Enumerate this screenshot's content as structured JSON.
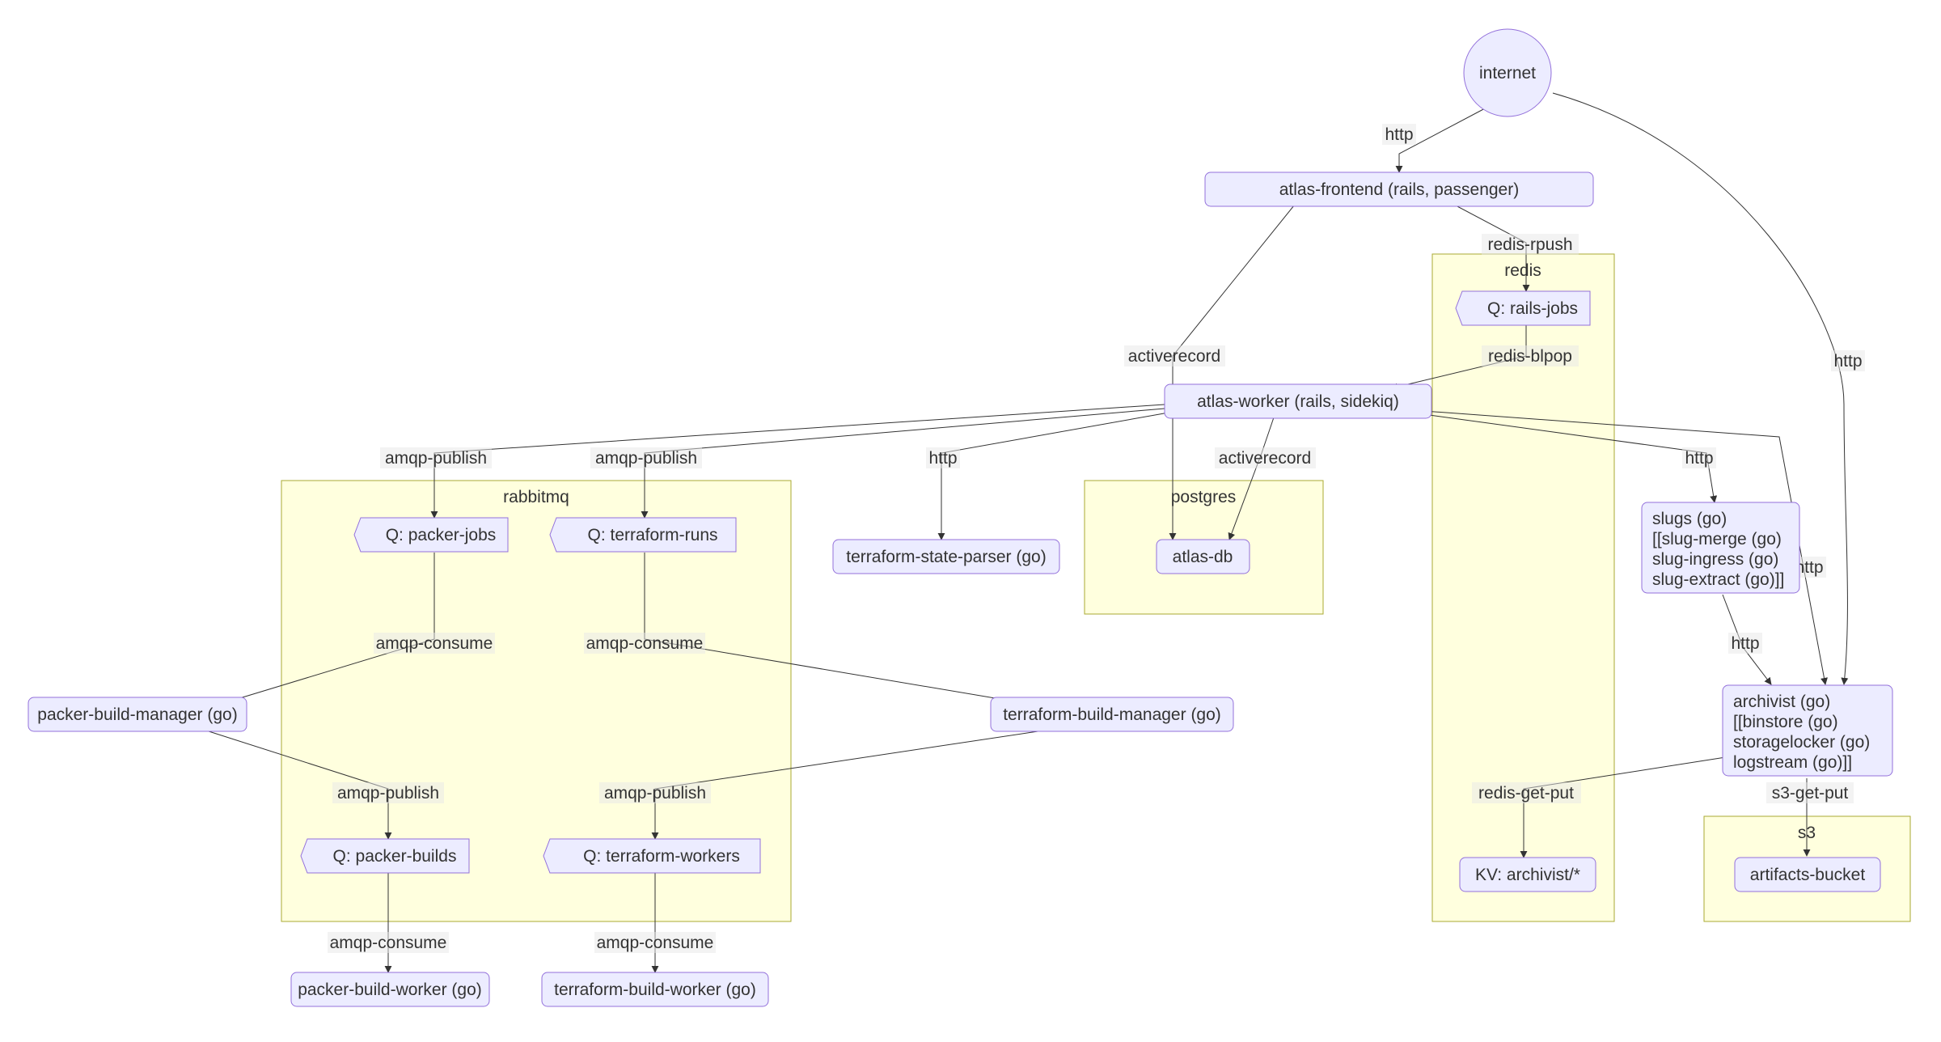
{
  "clusters": {
    "rabbitmq": "rabbitmq",
    "postgres": "postgres",
    "redis": "redis",
    "s3": "s3"
  },
  "nodes": {
    "internet": "internet",
    "atlas_frontend": "atlas-frontend (rails, passenger)",
    "atlas_worker": "atlas-worker (rails, sidekiq)",
    "atlas_db": "atlas-db",
    "q_rails_jobs": "Q: rails-jobs",
    "q_packer_jobs": "Q: packer-jobs",
    "q_terraform_runs": "Q: terraform-runs",
    "q_packer_builds": "Q: packer-builds",
    "q_terraform_workers": "Q: terraform-workers",
    "kv_archivist": "KV: archivist/*",
    "terraform_state_parser": "terraform-state-parser (go)",
    "packer_build_manager": "packer-build-manager (go)",
    "terraform_build_manager": "terraform-build-manager (go)",
    "packer_build_worker": "packer-build-worker (go)",
    "terraform_build_worker": "terraform-build-worker (go)",
    "slugs_l1": "slugs (go)",
    "slugs_l2": "[[slug-merge (go)",
    "slugs_l3": "slug-ingress (go)",
    "slugs_l4": "slug-extract (go)]]",
    "archivist_l1": "archivist (go)",
    "archivist_l2": "[[binstore (go)",
    "archivist_l3": "storagelocker (go)",
    "archivist_l4": "logstream (go)]]",
    "artifacts_bucket": "artifacts-bucket"
  },
  "edges": {
    "http": "http",
    "redis_rpush": "redis-rpush",
    "redis_blpop": "redis-blpop",
    "activerecord": "activerecord",
    "amqp_publish": "amqp-publish",
    "amqp_consume": "amqp-consume",
    "redis_get_put": "redis-get-put",
    "s3_get_put": "s3-get-put"
  }
}
